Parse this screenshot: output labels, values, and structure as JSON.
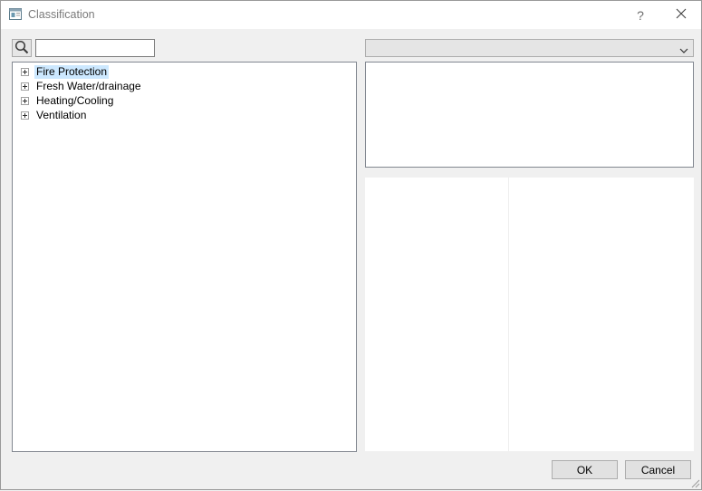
{
  "window": {
    "title": "Classification",
    "help_label": "?"
  },
  "search": {
    "value": "",
    "placeholder": ""
  },
  "tree": {
    "items": [
      {
        "label": "Fire Protection",
        "selected": true
      },
      {
        "label": "Fresh Water/drainage",
        "selected": false
      },
      {
        "label": "Heating/Cooling",
        "selected": false
      },
      {
        "label": "Ventilation",
        "selected": false
      }
    ]
  },
  "combo": {
    "selected": ""
  },
  "buttons": {
    "ok": "OK",
    "cancel": "Cancel"
  },
  "colors": {
    "selection": "#cce8ff",
    "window_bg": "#f0f0f0"
  },
  "icons": {
    "app": "app-window-icon",
    "search": "search-icon",
    "close": "close-icon",
    "dropdown": "chevron-down-icon",
    "expander": "plus-box-icon",
    "resize": "resize-grip-icon"
  }
}
